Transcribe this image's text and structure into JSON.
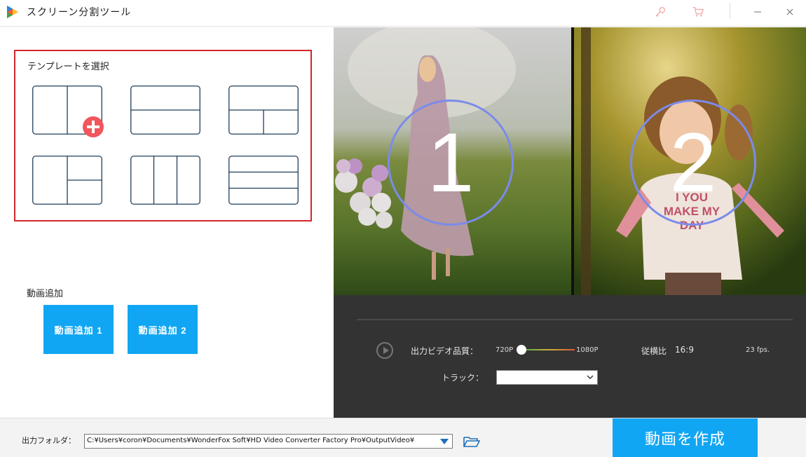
{
  "app": {
    "title": "スクリーン分割ツール"
  },
  "titlebar_icons": [
    "key-icon",
    "cart-icon",
    "minimize-icon",
    "close-icon"
  ],
  "templates": {
    "label": "テンプレートを選択",
    "items": [
      "split-vertical-2",
      "split-horizontal-2",
      "split-top-bottom-halves",
      "split-left-right-halves",
      "split-vertical-3",
      "split-horizontal-3"
    ],
    "selected": 0
  },
  "add_video": {
    "label": "動画追加",
    "button1": "動画追加 1",
    "button2": "動画追加 2"
  },
  "preview": {
    "pane1_number": "1",
    "pane2_number": "2",
    "pane2_shirt_text": "I YOU\nMAKE MY\nDAY"
  },
  "controls": {
    "quality_label": "出力ビデオ品質：",
    "quality_min": "720P",
    "quality_max": "1080P",
    "quality_value_fraction": 0.0,
    "aspect_label": "従横比",
    "aspect_value": "16:9",
    "fps": "23 fps.",
    "track_label": "トラック：",
    "track_value": ""
  },
  "output": {
    "label": "出力フォルダ：",
    "path": "C:¥Users¥coron¥Documents¥WonderFox Soft¥HD Video Converter Factory Pro¥OutputVideo¥"
  },
  "create_button": "動画を作成",
  "colors": {
    "accent": "#11a6f3",
    "highlight_border": "#d4262b",
    "add_badge": "#f0565c",
    "control_bg": "#333333",
    "template_stroke": "#1f3f5b"
  }
}
